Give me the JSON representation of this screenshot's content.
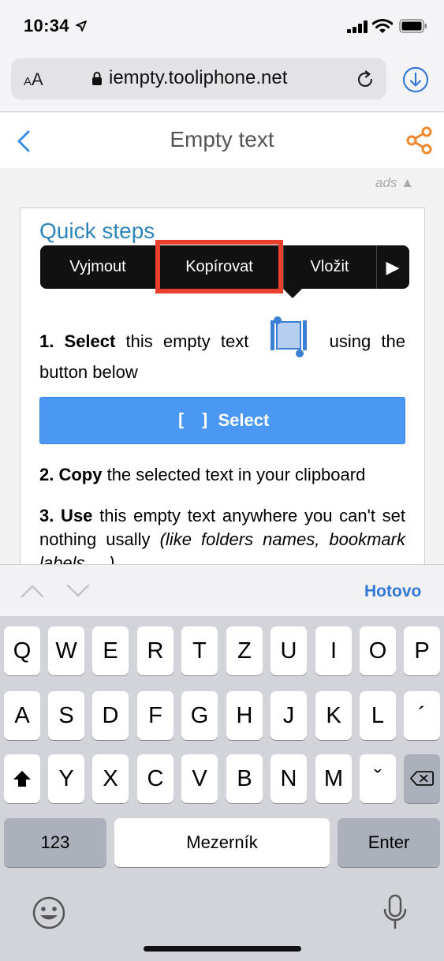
{
  "status_bar": {
    "time": "10:34"
  },
  "browser": {
    "aa_label_small": "A",
    "aa_label_large": "A",
    "url": "iempty.tooliphone.net"
  },
  "header": {
    "title": "Empty text"
  },
  "ads_label": "ads ▲",
  "card": {
    "heading": "Quick steps",
    "step1": {
      "num": "1.",
      "bold": "Select",
      "before_icon": " this empty text ",
      "after_icon": " using the button below"
    },
    "select_button": {
      "bracket": "[ ]",
      "label": "Select"
    },
    "step2": {
      "bold": "2. Copy",
      "text": " the selected text in your clipboard"
    },
    "step3": {
      "bold": "3. Use",
      "text": " this empty text anywhere you can't set nothing usally ",
      "italic": "(like folders names, bookmark labels, ...)"
    }
  },
  "context_menu": {
    "items": [
      "Vyjmout",
      "Kopírovat",
      "Vložit"
    ],
    "more_glyph": "▶",
    "highlighted": "Kopírovat",
    "highlight_color": "#e8402c"
  },
  "keyboard_toolbar": {
    "done_label": "Hotovo"
  },
  "keyboard": {
    "row1": [
      "Q",
      "W",
      "E",
      "R",
      "T",
      "Z",
      "U",
      "I",
      "O",
      "P"
    ],
    "row2": [
      "A",
      "S",
      "D",
      "F",
      "G",
      "H",
      "J",
      "K",
      "L",
      "´"
    ],
    "row3": [
      "Y",
      "X",
      "C",
      "V",
      "B",
      "N",
      "M",
      "ˇ"
    ],
    "numbers_label": "123",
    "space_label": "Mezerník",
    "enter_label": "Enter"
  },
  "colors": {
    "accent": "#4a98f4",
    "heading": "#2d84b8",
    "share": "#f0882c",
    "link": "#3478d6"
  }
}
